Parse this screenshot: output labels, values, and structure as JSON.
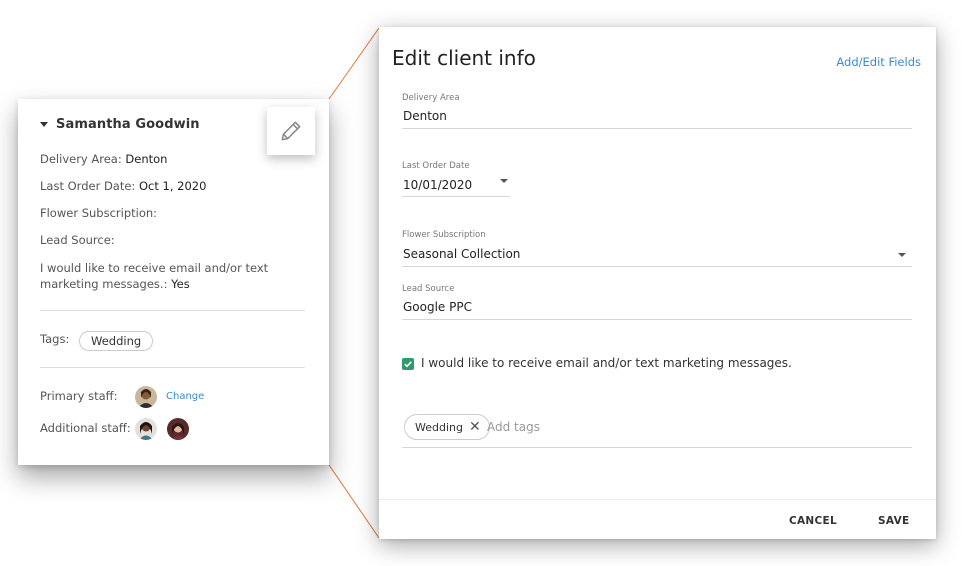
{
  "client_card": {
    "name": "Samantha Goodwin",
    "fields": [
      {
        "label": "Delivery Area:",
        "value": "Denton"
      },
      {
        "label": "Last Order Date:",
        "value": "Oct 1, 2020"
      },
      {
        "label": "Flower Subscription:",
        "value": ""
      },
      {
        "label": "Lead Source:",
        "value": ""
      }
    ],
    "consent_text": "I would like to receive email and/or text marketing messages.:",
    "consent_value": "Yes",
    "tags_label": "Tags:",
    "tags": [
      "Wedding"
    ],
    "primary_staff_label": "Primary staff:",
    "change_link": "Change",
    "additional_staff_label": "Additional staff:",
    "edit_icon": "pencil-icon"
  },
  "dialog": {
    "title": "Edit client info",
    "add_edit_fields_link": "Add/Edit Fields",
    "delivery_area": {
      "label": "Delivery Area",
      "value": "Denton"
    },
    "last_order_date": {
      "label": "Last Order Date",
      "value": "10/01/2020"
    },
    "flower_subscription": {
      "label": "Flower Subscription",
      "value": "Seasonal Collection"
    },
    "lead_source": {
      "label": "Lead Source",
      "value": "Google PPC"
    },
    "marketing_consent": {
      "label": "I would like to receive email and/or text marketing messages.",
      "checked": true
    },
    "tags": [
      "Wedding"
    ],
    "add_tags_placeholder": "Add tags",
    "cancel_label": "CANCEL",
    "save_label": "SAVE"
  },
  "colors": {
    "accent_link": "#3a8bd6",
    "checkbox_green": "#2f9a6b",
    "connector_orange": "#e0783a"
  }
}
